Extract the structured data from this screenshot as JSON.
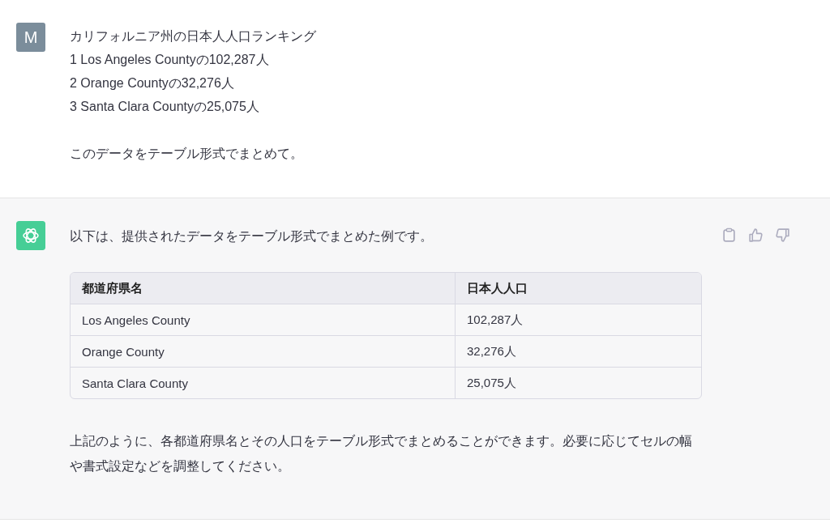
{
  "user_message": {
    "avatar": "M",
    "lines": [
      "カリフォルニア州の日本人人口ランキング",
      "1 Los Angeles Countyの102,287人",
      "2 Orange Countyの32,276人",
      "3 Santa Clara Countyの25,075人"
    ],
    "request": "このデータをテーブル形式でまとめて。"
  },
  "assistant_message": {
    "intro": "以下は、提供されたデータをテーブル形式でまとめた例です。",
    "table": {
      "columns": [
        "都道府県名",
        "日本人人口"
      ],
      "rows": [
        [
          "Los Angeles County",
          "102,287人"
        ],
        [
          "Orange County",
          "32,276人"
        ],
        [
          "Santa Clara County",
          "25,075人"
        ]
      ]
    },
    "outro": "上記のように、各都道府県名とその人口をテーブル形式でまとめることができます。必要に応じてセルの幅や書式設定などを調整してください。"
  }
}
